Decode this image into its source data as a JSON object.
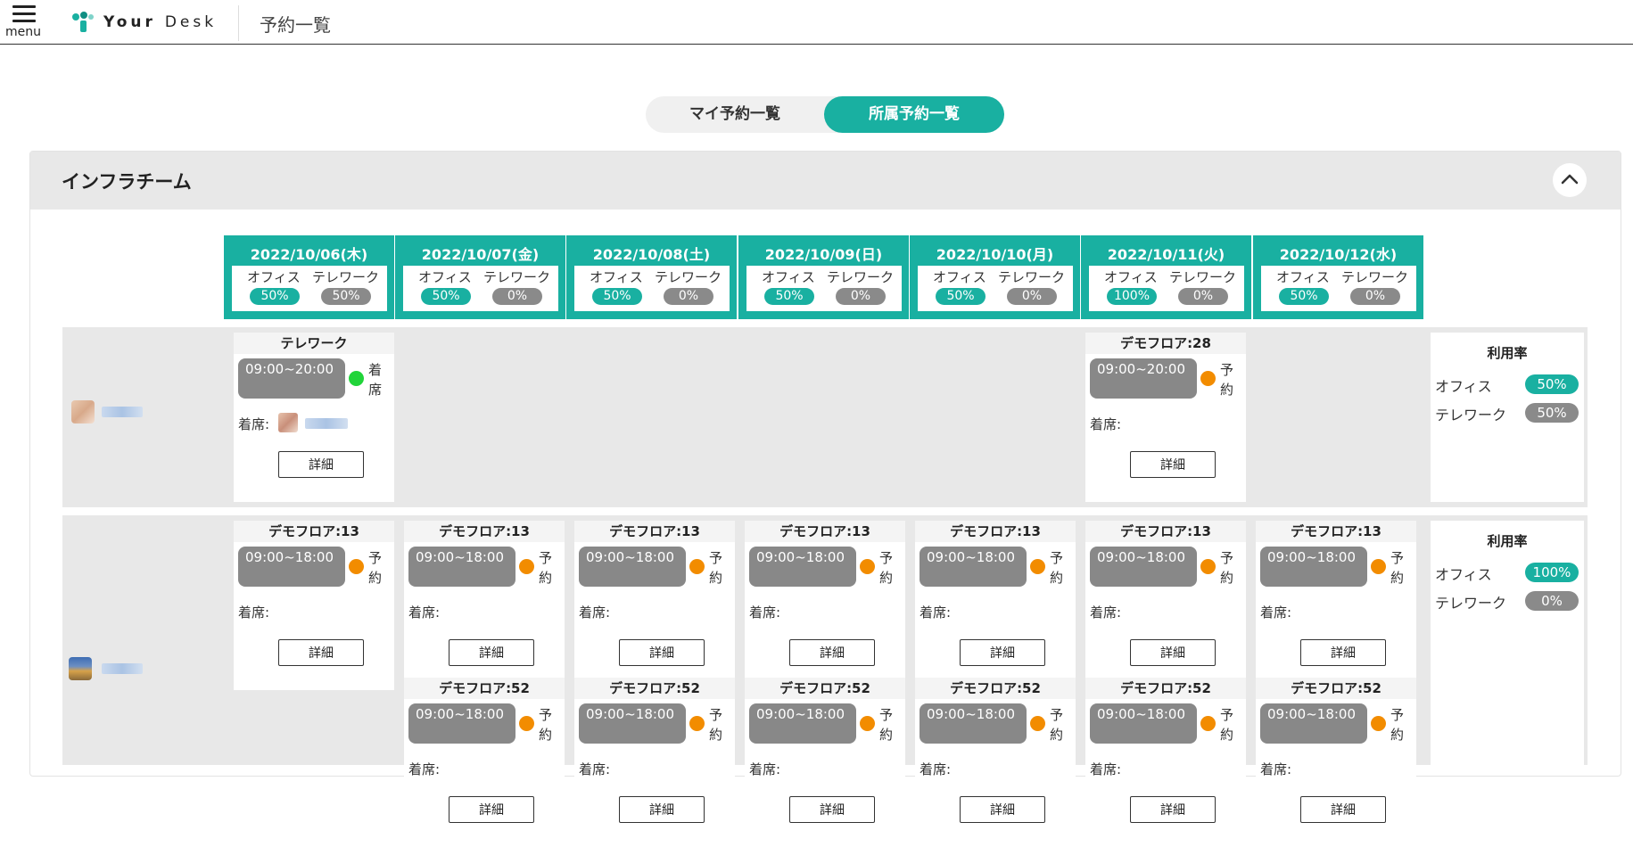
{
  "header": {
    "menu_label": "menu",
    "logo_text_bold": "Your",
    "logo_text_light": "Desk",
    "page_title": "予約一覧"
  },
  "tabs": {
    "my_reservations": "マイ予約一覧",
    "team_reservations": "所属予約一覧"
  },
  "team": {
    "name": "インフラチーム"
  },
  "labels": {
    "office": "オフィス",
    "telework": "テレワーク",
    "checkin": "着席:",
    "detail": "詳細",
    "usage_rate": "利用率"
  },
  "colors": {
    "accent": "#19b0a1",
    "gray_pill": "#8a8a8a",
    "reserved": "#f28c00",
    "checked_in": "#21d43a"
  },
  "dates": [
    {
      "date": "2022/10/06(木)",
      "office": "50%",
      "telework": "50%"
    },
    {
      "date": "2022/10/07(金)",
      "office": "50%",
      "telework": "0%"
    },
    {
      "date": "2022/10/08(土)",
      "office": "50%",
      "telework": "0%"
    },
    {
      "date": "2022/10/09(日)",
      "office": "50%",
      "telework": "0%"
    },
    {
      "date": "2022/10/10(月)",
      "office": "50%",
      "telework": "0%"
    },
    {
      "date": "2022/10/11(火)",
      "office": "100%",
      "telework": "0%"
    },
    {
      "date": "2022/10/12(水)",
      "office": "50%",
      "telework": "0%"
    }
  ],
  "members": [
    {
      "reservations": {
        "d0": {
          "title": "テレワーク",
          "time": "09:00~20:00",
          "status": "着席"
        },
        "d5": {
          "title": "デモフロア:28",
          "time": "09:00~20:00",
          "status": "予約"
        }
      },
      "rate": {
        "office": "50%",
        "telework": "50%"
      }
    },
    {
      "reservations": {
        "d0": {
          "title": "デモフロア:13",
          "time": "09:00~18:00",
          "status": "予約"
        },
        "d1": {
          "title": "デモフロア:13",
          "time": "09:00~18:00",
          "status": "予約"
        },
        "d2": {
          "title": "デモフロア:13",
          "time": "09:00~18:00",
          "status": "予約"
        },
        "d3": {
          "title": "デモフロア:13",
          "time": "09:00~18:00",
          "status": "予約"
        },
        "d4": {
          "title": "デモフロア:13",
          "time": "09:00~18:00",
          "status": "予約"
        },
        "d5": {
          "title": "デモフロア:13",
          "time": "09:00~18:00",
          "status": "予約"
        },
        "d6": {
          "title": "デモフロア:13",
          "time": "09:00~18:00",
          "status": "予約"
        },
        "e1": {
          "title": "デモフロア:52",
          "time": "09:00~18:00",
          "status": "予約"
        },
        "e2": {
          "title": "デモフロア:52",
          "time": "09:00~18:00",
          "status": "予約"
        },
        "e3": {
          "title": "デモフロア:52",
          "time": "09:00~18:00",
          "status": "予約"
        },
        "e4": {
          "title": "デモフロア:52",
          "time": "09:00~18:00",
          "status": "予約"
        },
        "e5": {
          "title": "デモフロア:52",
          "time": "09:00~18:00",
          "status": "予約"
        },
        "e6": {
          "title": "デモフロア:52",
          "time": "09:00~18:00",
          "status": "予約"
        }
      },
      "rate": {
        "office": "100%",
        "telework": "0%"
      }
    }
  ]
}
